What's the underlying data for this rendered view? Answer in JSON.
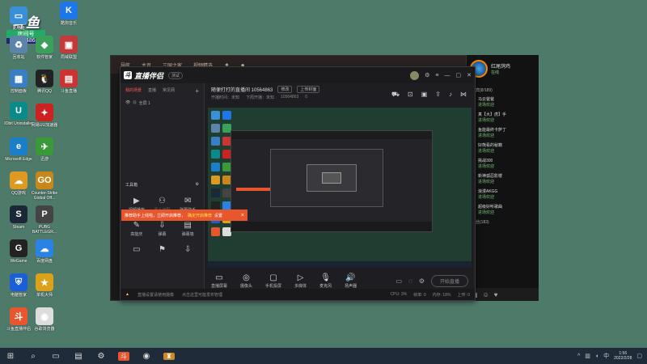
{
  "desktop": {
    "watermark": {
      "logo": "斗鱼",
      "label": "房间号",
      "number": "10564863"
    },
    "icons": [
      {
        "label": "此电脑",
        "color": "#3b8fd6",
        "glyph": "▭"
      },
      {
        "label": "酷狗音乐",
        "color": "#1e77e8",
        "glyph": "K"
      },
      {
        "label": "回收站",
        "color": "#5b84a8",
        "glyph": "♻"
      },
      {
        "label": "软件管家",
        "color": "#3aa05a",
        "glyph": "◆"
      },
      {
        "label": "局域联盟",
        "color": "#c43a3a",
        "glyph": "▣"
      },
      {
        "label": "控制面板",
        "color": "#3a7fc4",
        "glyph": "▦"
      },
      {
        "label": "腾讯QQ",
        "color": "#222",
        "glyph": "🐧"
      },
      {
        "label": "斗鱼直播",
        "color": "#c33",
        "glyph": "▤"
      },
      {
        "label": "IObit Uninstaller",
        "color": "#0a8a8a",
        "glyph": "U"
      },
      {
        "label": "网易UU加速器",
        "color": "#c22",
        "glyph": "✦"
      },
      {
        "label": "Microsoft Edge",
        "color": "#1a7fc8",
        "glyph": "e"
      },
      {
        "label": "迅游",
        "color": "#3a9a3a",
        "glyph": "✈"
      },
      {
        "label": "QQ游戏",
        "color": "#d92",
        "glyph": "☁"
      },
      {
        "label": "Counter-Strike Global Off...",
        "color": "#c8871a",
        "glyph": "GO"
      },
      {
        "label": "Steam",
        "color": "#1b2838",
        "glyph": "S"
      },
      {
        "label": "PUBG BATTLEGR...",
        "color": "#444",
        "glyph": "P"
      },
      {
        "label": "WeGame",
        "color": "#222",
        "glyph": "G"
      },
      {
        "label": "百度网盘",
        "color": "#2a82e4",
        "glyph": "☁"
      },
      {
        "label": "电脑管家",
        "color": "#1a5fd8",
        "glyph": "⛨"
      },
      {
        "label": "单机大师",
        "color": "#d9a21a",
        "glyph": "★"
      },
      {
        "label": "斗鱼直播伴侣",
        "color": "#e8562e",
        "glyph": "斗"
      },
      {
        "label": "谷歌浏览器",
        "color": "#ddd",
        "glyph": "◉"
      }
    ]
  },
  "bg_window": {
    "header_items": [
      "导航",
      "主页",
      "三国之家",
      "视频精选"
    ],
    "streamer": "红尾鸽鸡",
    "streamer_status": "在线",
    "chat_count": "贵宾(8/189)",
    "chat_rows": [
      {
        "user": "马云爸爸",
        "status": "进场欢迎"
      },
      {
        "user": "真【大】虎】手",
        "status": "进场欢迎"
      },
      {
        "user": "鱼能最终卡萨丁",
        "status": "进场欢迎"
      },
      {
        "user": "好熊看的秘籍",
        "status": "进场欢迎"
      },
      {
        "user": "挑战300",
        "status": "进场欢迎"
      },
      {
        "user": "新神孤忍影楼",
        "status": "进场欢迎"
      },
      {
        "user": "浪漫AKGG",
        "status": "进场欢迎"
      },
      {
        "user": "超级好听歌曲",
        "status": "进场欢迎"
      }
    ],
    "fans_section": "粉丝(183)"
  },
  "app": {
    "title": "直播伴侣",
    "version": "测试",
    "titlebar_icons": [
      "settings-icon",
      "menu-icon",
      "minimize-icon",
      "maximize-icon",
      "close-icon"
    ],
    "sidebar_tabs": [
      "我的场景",
      "直播",
      "常见网"
    ],
    "scene_label": "全屏 1",
    "tools_header": "工具箱",
    "tools": [
      {
        "label": "视频播放",
        "glyph": "▶",
        "dim": false
      },
      {
        "label": "素人速配",
        "glyph": "⚇",
        "dim": true
      },
      {
        "label": "弹幕助手",
        "glyph": "✉",
        "dim": false
      },
      {
        "label": "高能庆",
        "glyph": "✎",
        "dim": false
      },
      {
        "label": "弹幕",
        "glyph": "⇩",
        "dim": false
      },
      {
        "label": "弹幕墙",
        "glyph": "▤",
        "dim": false
      },
      {
        "label": "",
        "glyph": "▭",
        "dim": false
      },
      {
        "label": "",
        "glyph": "⚑",
        "dim": false
      },
      {
        "label": "",
        "glyph": "⇩",
        "dim": false
      }
    ],
    "notice": {
      "prefix": "推荐助手上线啦，立即开启推荐，",
      "highlight": "确定开启推荐",
      "suffix": "设置"
    },
    "room_title": "随便打打的直播间 10564863",
    "room_title_btns": [
      "修改",
      "上传封面"
    ],
    "room_sub": [
      "开播时间：未知",
      "下周开播：未知",
      "10564863",
      "0"
    ],
    "controls": [
      {
        "label": "直播屏幕",
        "glyph": "▭"
      },
      {
        "label": "摄像头",
        "glyph": "◎"
      },
      {
        "label": "手机投屏",
        "glyph": "▢"
      },
      {
        "label": "多媒体",
        "glyph": "▷"
      },
      {
        "label": "麦克风",
        "glyph": "🎙"
      },
      {
        "label": "扬声器",
        "glyph": "🔊"
      }
    ],
    "go_live": "开始直播",
    "status_warn": "直播设置请使用摄像",
    "status_text": "点击这里可能发布管理",
    "status_right": [
      "CPU: 3%",
      "帧率: 0",
      "内存: 18%",
      "上传: 0"
    ]
  },
  "taskbar": {
    "time": "1:56",
    "date": "2022/2/28",
    "tray_text": "中"
  },
  "colors": {
    "accent": "#e8562e",
    "desktop": "#4e7a6a"
  }
}
